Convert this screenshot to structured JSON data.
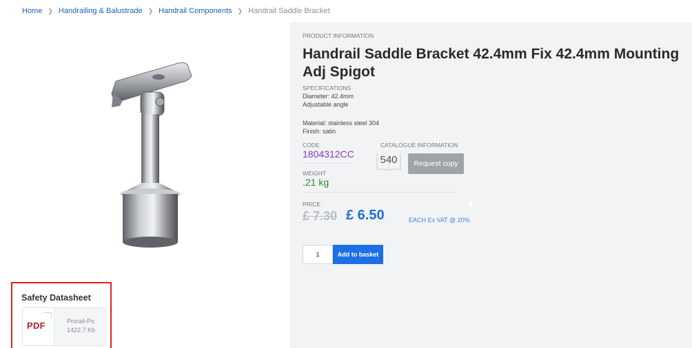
{
  "breadcrumb": {
    "items": [
      "Home",
      "Handrailing & Balustrade",
      "Handrail Components"
    ],
    "current": "Handrail Saddle Bracket"
  },
  "product": {
    "image_icon": "handrail-saddle-bracket-image"
  },
  "safety": {
    "title": "Safety Datasheet",
    "file_type": "PDF",
    "file_name": "Prorail-Po",
    "file_size": "1422.7 Kb"
  },
  "info": {
    "section_label": "PRODUCT INFORMATION",
    "title": "Handrail Saddle Bracket 42.4mm Fix 42.4mm Mounting Adj Spigot",
    "specifications_label": "SPECIFICATIONS",
    "spec_lines": [
      "Diameter: 42.4mm",
      "Adjustable angle"
    ],
    "material": "Material: stainless steel 304",
    "finish": "Finish: satin",
    "code_label": "CODE",
    "code": "1804312CC",
    "weight_label": "WEIGHT",
    "weight": ".21 kg",
    "catalogue_label": "CATALOGUE INFORMATION",
    "catalogue_page": "540",
    "request_copy": "Request copy",
    "price_label": "PRICE",
    "old_price": "£ 7.30",
    "new_price": "£ 6.50",
    "price_suffix": "EACH Ex VAT @ 20%",
    "quantity": "1",
    "add_to_basket": "Add to basket"
  },
  "colors": {
    "link": "#1f5fae",
    "code": "#7a3fc1",
    "weight": "#2e8b3a",
    "price": "#1f6fd1",
    "basket_button": "#1d6fe6",
    "highlight_border": "#e02020"
  }
}
